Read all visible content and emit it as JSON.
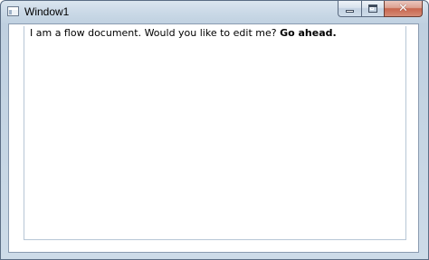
{
  "window": {
    "title": "Window1",
    "icon": "window-app-icon",
    "caption_buttons": {
      "minimize_icon": "minimize-icon",
      "maximize_icon": "maximize-icon",
      "close_icon": "close-icon",
      "close_glyph": "✕"
    }
  },
  "document": {
    "text_plain": "I am a flow document. Would you like to edit me? ",
    "text_bold": "Go ahead."
  },
  "colors": {
    "frame": "#cddbe8",
    "close_button": "#c8654d",
    "document_background": "#ffffff",
    "text": "#000000"
  }
}
